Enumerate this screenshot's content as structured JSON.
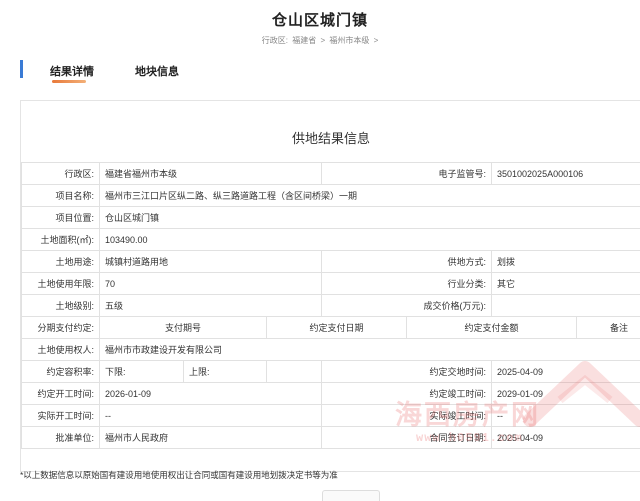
{
  "page": {
    "title": "仓山区城门镇"
  },
  "breadcrumb": {
    "prefix": "行政区:",
    "items": [
      "福建省",
      "福州市本级"
    ],
    "sep": ">"
  },
  "tabs": [
    {
      "label": "结果详情",
      "active": true
    },
    {
      "label": "地块信息",
      "active": false
    }
  ],
  "colors": {
    "accent": "#3a7bd5",
    "tab_underline": "#e8793a",
    "watermark": "#e96e6e"
  },
  "panel": {
    "title": "供地结果信息"
  },
  "fields": {
    "district": {
      "label": "行政区:",
      "value": "福建省福州市本级"
    },
    "supervision_no": {
      "label": "电子监管号:",
      "value": "3501002025A000106"
    },
    "project_name": {
      "label": "项目名称:",
      "value": "福州市三江口片区纵二路、纵三路道路工程（含区间桥梁）一期"
    },
    "project_location": {
      "label": "项目位置:",
      "value": "仓山区城门镇"
    },
    "land_area": {
      "label": "土地面积(㎡):",
      "value": "103490.00"
    },
    "land_use": {
      "label": "土地用途:",
      "value": "城镇村道路用地"
    },
    "supply_method": {
      "label": "供地方式:",
      "value": "划拨"
    },
    "use_years": {
      "label": "土地使用年限:",
      "value": "70"
    },
    "industry": {
      "label": "行业分类:",
      "value": "其它"
    },
    "land_grade": {
      "label": "土地级别:",
      "value": "五级"
    },
    "deal_price": {
      "label": "成交价格(万元):",
      "value": ""
    },
    "installments": {
      "label": "分期支付约定:",
      "headers": [
        "支付期号",
        "约定支付日期",
        "约定支付金额",
        "备注"
      ]
    },
    "land_user": {
      "label": "土地使用权人:",
      "value": "福州市市政建设开发有限公司"
    },
    "plot_ratio": {
      "label": "约定容积率:",
      "lower_label": "下限:",
      "lower": "",
      "upper_label": "上限:",
      "upper": ""
    },
    "delivery_date": {
      "label": "约定交地时间:",
      "value": "2025-04-09"
    },
    "start_date": {
      "label": "约定开工时间:",
      "value": "2026-01-09"
    },
    "finish_date": {
      "label": "约定竣工时间:",
      "value": "2029-01-09"
    },
    "actual_start": {
      "label": "实际开工时间:",
      "value": "--"
    },
    "actual_finish": {
      "label": "实际竣工时间:",
      "value": "--"
    },
    "approver": {
      "label": "批准单位:",
      "value": "福州市人民政府"
    },
    "contract_date": {
      "label": "合同签订日期:",
      "value": "2025-04-09"
    }
  },
  "footnote": "*以上数据信息以原始国有建设用地使用权出让合同或国有建设用地划拨决定书等为准",
  "watermark": {
    "line1": "海西房产网",
    "line2": "www.h0591.com"
  }
}
